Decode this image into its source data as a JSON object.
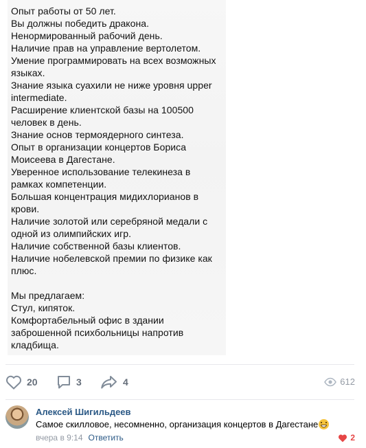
{
  "post": {
    "lines": [
      "Опыт работы от 50 лет.",
      "Вы должны победить дракона.",
      "Ненормированный рабочий день.",
      "Наличие прав на управление вертолетом.",
      "Умение программировать на всех возможных",
      "языках.",
      "Знание языка суахили не ниже уровня upper",
      "intermediate.",
      "Расширение клиентской базы на 100500",
      "человек в день.",
      "Знание основ термоядерного синтеза.",
      "Опыт в организации концертов Бориса",
      "Моисеева в Дагестане.",
      "Уверенное использование телекинеза в",
      "рамках компетенции.",
      "Большая концентрация мидихлорианов в",
      "крови.",
      "Наличие золотой или серебряной медали с",
      "одной из олимпийских игр.",
      "Наличие собственной базы клиентов.",
      "Наличие нобелевской премии по физике как",
      "плюс.",
      "",
      "Мы предлагаем:",
      "Стул, кипяток.",
      "Комфортабельный офис в здании",
      "заброшенной психбольницы напротив",
      "кладбища."
    ]
  },
  "actions": {
    "likes": "20",
    "comments": "3",
    "shares": "4",
    "views": "612",
    "icons": [
      "heart-icon",
      "comment-icon",
      "share-icon",
      "eye-icon"
    ],
    "icon_color": "#818c99"
  },
  "comment": {
    "author": "Алексей Шигильдеев",
    "text": "Самое скилловое, несомненно, организация концертов в Дагестане",
    "emoji": "grinning-face-emoji",
    "time": "вчера в 9:14",
    "reply_label": "Ответить",
    "likes": "2",
    "like_color": "#e64646",
    "author_color": "#2a5885"
  }
}
